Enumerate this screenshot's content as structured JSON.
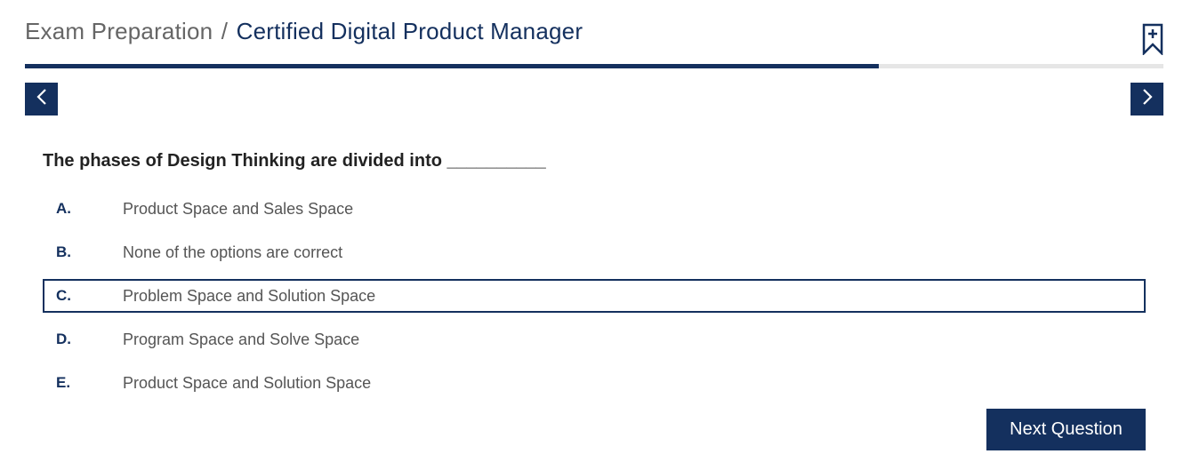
{
  "breadcrumb": {
    "parent": "Exam Preparation",
    "separator": "/",
    "current": "Certified Digital Product Manager"
  },
  "bookmark": {
    "icon": "bookmark-add-icon"
  },
  "progress": {
    "fraction": 0.75
  },
  "navigation": {
    "prev_icon": "chevron-left-icon",
    "next_icon": "chevron-right-icon"
  },
  "question": {
    "text": "The phases of Design Thinking are divided into __________"
  },
  "options": [
    {
      "letter": "A.",
      "text": "Product Space and Sales Space"
    },
    {
      "letter": "B.",
      "text": "None of the options are correct"
    },
    {
      "letter": "C.",
      "text": "Problem Space and Solution Space"
    },
    {
      "letter": "D.",
      "text": "Program Space and Solve Space"
    },
    {
      "letter": "E.",
      "text": "Product Space and Solution Space"
    }
  ],
  "selected_option_index": 2,
  "next_button": {
    "label": "Next Question"
  },
  "colors": {
    "accent": "#14305e",
    "muted_text": "#555555",
    "track": "#e6e6e6"
  }
}
